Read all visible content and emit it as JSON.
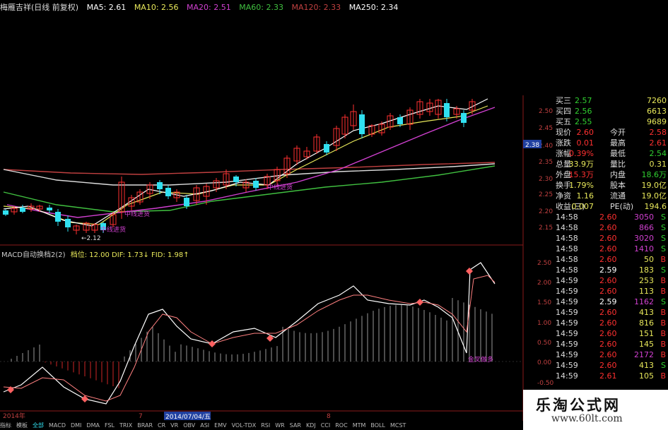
{
  "header": {
    "stock_name": "梅雁吉祥(日线 前复权)",
    "ma": [
      {
        "label": "MA5: 2.61",
        "color": "#ffffff"
      },
      {
        "label": "MA10: 2.56",
        "color": "#e8e85a"
      },
      {
        "label": "MA20: 2.51",
        "color": "#d040d0"
      },
      {
        "label": "MA60: 2.33",
        "color": "#40c040"
      },
      {
        "label": "MA120: 2.33",
        "color": "#c04040"
      },
      {
        "label": "MA250: 2.34",
        "color": "#ffffff"
      }
    ]
  },
  "price_axis": [
    "2.50",
    "2.45",
    "2.40",
    "2.35",
    "2.30",
    "2.25",
    "2.20",
    "2.15"
  ],
  "current_price_tag": "2.38",
  "chart_labels": {
    "low_label": "2.12",
    "buy1": "中线进货",
    "buy2": "中线进货",
    "buy3": "中线进货"
  },
  "indicator": {
    "title": "MACD自动换档2(2)",
    "params": "档位: 12.00  DIF: 1.73↓  FID: 1.98↑",
    "label": "金叉做多",
    "axis": [
      "2.50",
      "2.00",
      "1.50",
      "1.00",
      "0.50",
      "0.00",
      "-0.50"
    ]
  },
  "time_axis": {
    "year": "2014年",
    "m7": "7",
    "date": "2014/07/04/五",
    "m8": "8"
  },
  "quote": {
    "buy_rows": [
      {
        "label": "买三",
        "price": "2.57",
        "vol": "7260"
      },
      {
        "label": "买四",
        "price": "2.56",
        "vol": "6613"
      },
      {
        "label": "买五",
        "price": "2.55",
        "vol": "9689"
      }
    ],
    "stats": [
      {
        "l1": "现价",
        "v1": "2.60",
        "c1": "#ff3030",
        "l2": "今开",
        "v2": "2.58",
        "c2": "#ff3030"
      },
      {
        "l1": "涨跌",
        "v1": "0.01",
        "c1": "#ff3030",
        "l2": "最高",
        "v2": "2.61",
        "c2": "#ff3030"
      },
      {
        "l1": "涨幅",
        "v1": "0.39%",
        "c1": "#ff3030",
        "l2": "最低",
        "v2": "2.54",
        "c2": "#30d030"
      },
      {
        "l1": "总量",
        "v1": "33.9万",
        "c1": "#e8e85a",
        "l2": "量比",
        "v2": "0.31",
        "c2": "#e8e85a"
      },
      {
        "l1": "外盘",
        "v1": "15.3万",
        "c1": "#ff3030",
        "l2": "内盘",
        "v2": "18.6万",
        "c2": "#30d030"
      },
      {
        "l1": "换手",
        "v1": "1.79%",
        "c1": "#e8e85a",
        "l2": "股本",
        "v2": "19.0亿",
        "c2": "#e8e85a"
      },
      {
        "l1": "净资",
        "v1": "1.16",
        "c1": "#e8e85a",
        "l2": "流通",
        "v2": "19.0亿",
        "c2": "#e8e85a"
      },
      {
        "l1": "收益(三)",
        "v1": "0.007",
        "c1": "#e8e85a",
        "l2": "PE(动)",
        "v2": "194.6",
        "c2": "#e8e85a"
      }
    ],
    "ticks": [
      {
        "t": "14:58",
        "p": "2.60",
        "pc": "#ff3030",
        "v": "3050",
        "vc": "#d040d0",
        "s": "S",
        "sc": "#30d030"
      },
      {
        "t": "14:58",
        "p": "2.60",
        "pc": "#ff3030",
        "v": "866",
        "vc": "#d040d0",
        "s": "S",
        "sc": "#30d030"
      },
      {
        "t": "14:58",
        "p": "2.60",
        "pc": "#ff3030",
        "v": "3020",
        "vc": "#d040d0",
        "s": "S",
        "sc": "#30d030"
      },
      {
        "t": "14:58",
        "p": "2.60",
        "pc": "#ff3030",
        "v": "1410",
        "vc": "#d040d0",
        "s": "S",
        "sc": "#30d030"
      },
      {
        "t": "14:58",
        "p": "2.60",
        "pc": "#ff3030",
        "v": "50",
        "vc": "#e8e85a",
        "s": "B",
        "sc": "#ff3030"
      },
      {
        "t": "14:58",
        "p": "2.59",
        "pc": "#ffffff",
        "v": "183",
        "vc": "#e8e85a",
        "s": "S",
        "sc": "#30d030"
      },
      {
        "t": "14:59",
        "p": "2.60",
        "pc": "#ff3030",
        "v": "253",
        "vc": "#e8e85a",
        "s": "B",
        "sc": "#ff3030"
      },
      {
        "t": "14:59",
        "p": "2.60",
        "pc": "#ff3030",
        "v": "113",
        "vc": "#e8e85a",
        "s": "B",
        "sc": "#ff3030"
      },
      {
        "t": "14:59",
        "p": "2.59",
        "pc": "#ffffff",
        "v": "1162",
        "vc": "#d040d0",
        "s": "S",
        "sc": "#30d030"
      },
      {
        "t": "14:59",
        "p": "2.60",
        "pc": "#ff3030",
        "v": "413",
        "vc": "#e8e85a",
        "s": "B",
        "sc": "#ff3030"
      },
      {
        "t": "14:59",
        "p": "2.60",
        "pc": "#ff3030",
        "v": "816",
        "vc": "#e8e85a",
        "s": "B",
        "sc": "#ff3030"
      },
      {
        "t": "14:59",
        "p": "2.60",
        "pc": "#ff3030",
        "v": "151",
        "vc": "#e8e85a",
        "s": "B",
        "sc": "#ff3030"
      },
      {
        "t": "14:59",
        "p": "2.60",
        "pc": "#ff3030",
        "v": "145",
        "vc": "#e8e85a",
        "s": "B",
        "sc": "#ff3030"
      },
      {
        "t": "14:59",
        "p": "2.60",
        "pc": "#ff3030",
        "v": "2172",
        "vc": "#d040d0",
        "s": "B",
        "sc": "#ff3030"
      },
      {
        "t": "14:59",
        "p": "2.60",
        "pc": "#ff3030",
        "v": "413",
        "vc": "#e8e85a",
        "s": "S",
        "sc": "#30d030"
      },
      {
        "t": "14:59",
        "p": "2.61",
        "pc": "#ff3030",
        "v": "105",
        "vc": "#e8e85a",
        "s": "B",
        "sc": "#ff3030"
      }
    ]
  },
  "bottom_tabs": [
    "指标",
    "模板",
    "全部",
    "MACD",
    "DMI",
    "DMA",
    "FSL",
    "TRIX",
    "BRAR",
    "CR",
    "VR",
    "OBV",
    "ASI",
    "EMV",
    "VOL-TDX",
    "RSI",
    "WR",
    "SAR",
    "KDJ",
    "CCI",
    "ROC",
    "MTM",
    "BOLL",
    "MCST"
  ],
  "watermark": {
    "cn": "乐淘公式网",
    "url": "www.60lt.com"
  }
}
